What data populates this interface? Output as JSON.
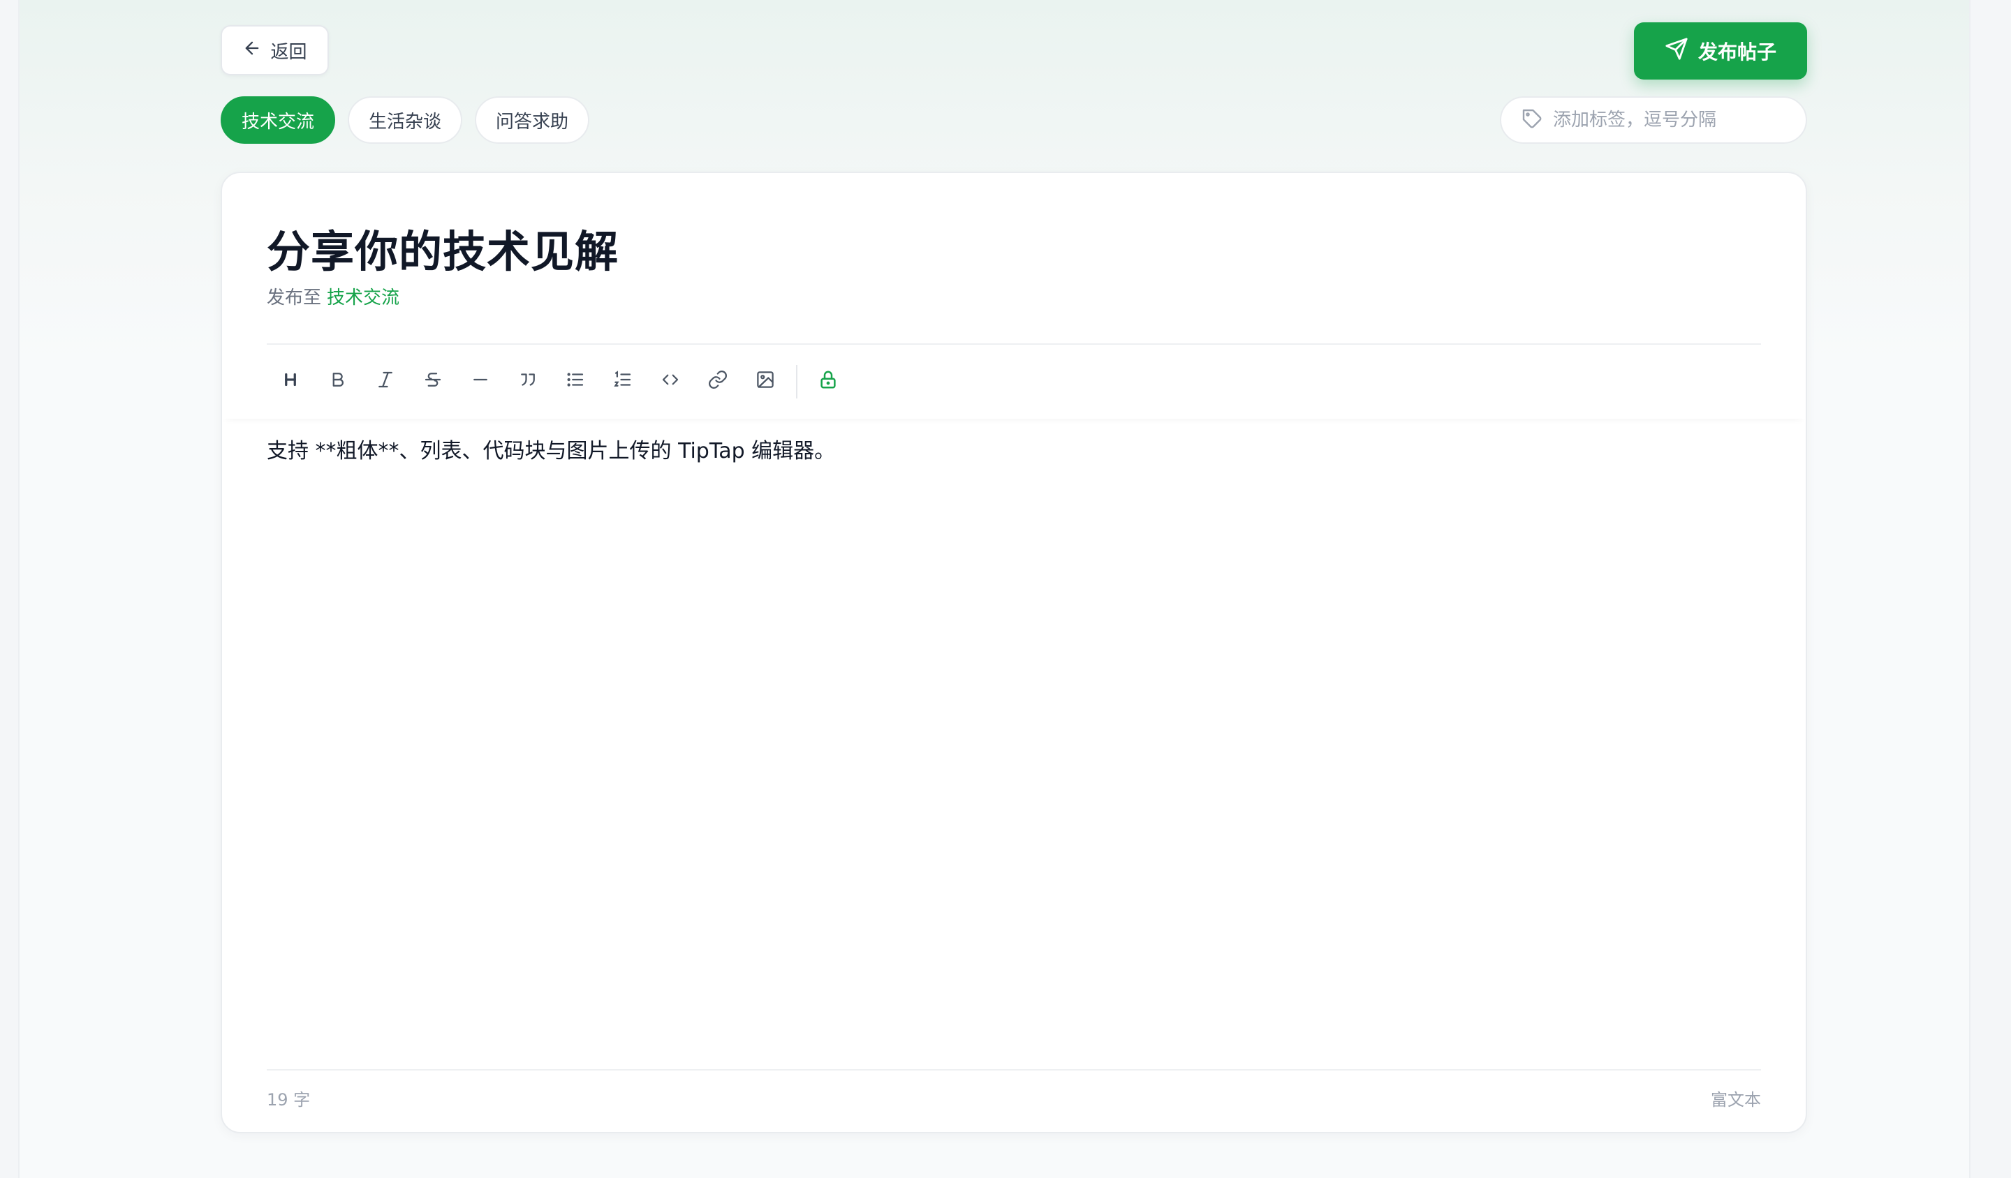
{
  "header": {
    "back_label": "返回",
    "publish_label": "发布帖子"
  },
  "categories": [
    {
      "label": "技术交流",
      "active": true
    },
    {
      "label": "生活杂谈",
      "active": false
    },
    {
      "label": "问答求助",
      "active": false
    }
  ],
  "tags": {
    "placeholder": "添加标签，逗号分隔",
    "value": ""
  },
  "card": {
    "title": "分享你的技术见解",
    "publish_to_prefix": "发布至",
    "publish_to_category": "技术交流"
  },
  "toolbar": {
    "items": [
      "heading-icon",
      "bold-icon",
      "italic-icon",
      "strikethrough-icon",
      "horizontal-rule-icon",
      "blockquote-icon",
      "bullet-list-icon",
      "ordered-list-icon",
      "code-icon",
      "link-icon",
      "image-icon",
      "lock-icon"
    ]
  },
  "editor": {
    "content": "支持 **粗体**、列表、代码块与图片上传的 TipTap 编辑器。"
  },
  "footer": {
    "word_count": "19 字",
    "mode": "富文本"
  },
  "colors": {
    "accent": "#16a34a",
    "text": "#111827",
    "muted": "#9ca3af"
  }
}
